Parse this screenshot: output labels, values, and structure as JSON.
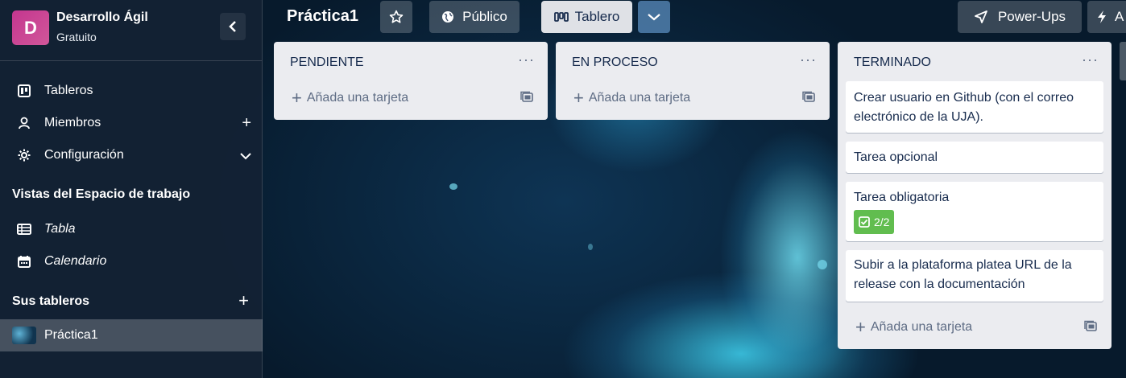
{
  "workspace": {
    "avatar_letter": "D",
    "name": "Desarrollo Ágil",
    "plan": "Gratuito",
    "collapse_icon": "‹"
  },
  "sidebar": {
    "items": [
      {
        "label": "Tableros",
        "icon": "board-icon"
      },
      {
        "label": "Miembros",
        "icon": "person-icon",
        "action": "+"
      },
      {
        "label": "Configuración",
        "icon": "gear-icon",
        "action": "chevron-down"
      }
    ],
    "views_title": "Vistas del Espacio de trabajo",
    "views": [
      {
        "label": "Tabla",
        "icon": "table-icon"
      },
      {
        "label": "Calendario",
        "icon": "calendar-icon"
      }
    ],
    "boards_title": "Sus tableros",
    "boards_plus": "+",
    "boards": [
      {
        "label": "Práctica1"
      }
    ]
  },
  "header": {
    "board_title": "Práctica1",
    "visibility_label": "Público",
    "view_label": "Tablero",
    "powerups_label": "Power-Ups",
    "automation_label": "A"
  },
  "lists": [
    {
      "title": "PENDIENTE",
      "menu": "···",
      "add_card": "Añada una tarjeta",
      "cards": []
    },
    {
      "title": "EN PROCESO",
      "menu": "···",
      "add_card": "Añada una tarjeta",
      "cards": []
    },
    {
      "title": "TERMINADO",
      "menu": "···",
      "add_card": "Añada una tarjeta",
      "cards": [
        {
          "title": "Crear usuario en Github (con el correo electrónico de la UJA)."
        },
        {
          "title": "Tarea opcional"
        },
        {
          "title": "Tarea obligatoria",
          "checklist": "2/2"
        },
        {
          "title": "Subir a la plataforma platea URL de la release con la documentación"
        }
      ]
    }
  ],
  "colors": {
    "avatar": "#c4368f",
    "list_bg": "#ebecf0",
    "badge_green": "#61bd4f"
  }
}
